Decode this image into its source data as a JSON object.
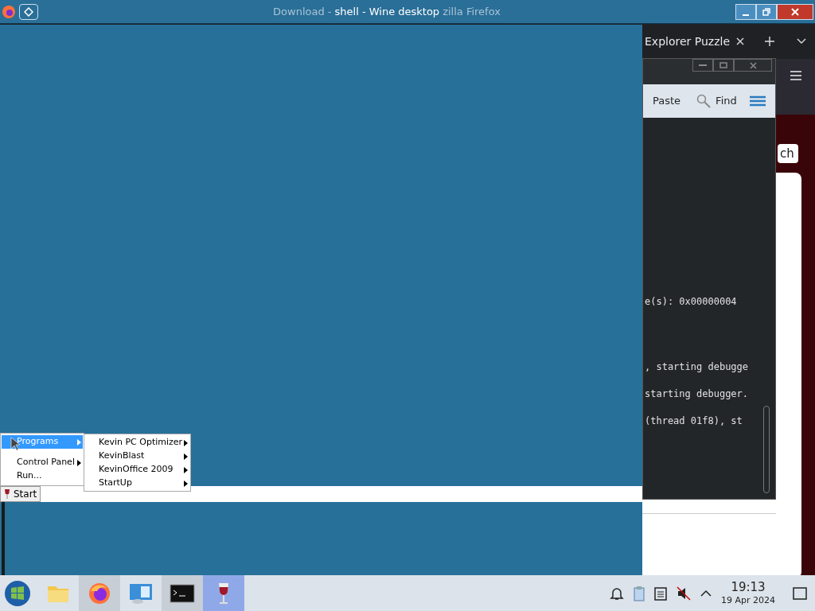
{
  "window": {
    "title": "shell - Wine desktop",
    "behind_title_left": "Download -",
    "behind_title_right": "zilla Firefox"
  },
  "start_menu": {
    "items": [
      {
        "label": "Programs",
        "selected": true,
        "submenu": true
      },
      {
        "label": "Control Panel",
        "selected": false,
        "submenu": true
      },
      {
        "label": "Run...",
        "selected": false,
        "submenu": false
      }
    ]
  },
  "submenu": {
    "items": [
      {
        "label": "Kevin PC Optimizer"
      },
      {
        "label": "KevinBlast"
      },
      {
        "label": "KevinOffice 2009"
      },
      {
        "label": "StartUp"
      }
    ]
  },
  "wine_taskbar": {
    "start": "Start"
  },
  "browser": {
    "tab": "Explorer Puzzle",
    "search_button": "ch"
  },
  "terminal": {
    "toolbar": [
      "Paste",
      "Find"
    ],
    "lines": [
      "e(s): 0x00000004",
      ", starting debugge",
      "starting debugger.",
      "(thread 01f8), st"
    ]
  },
  "taskbar": {
    "apps": [
      {
        "kind": "folder",
        "selected": false
      },
      {
        "kind": "firefox",
        "selected": true
      },
      {
        "kind": "remote",
        "selected": false
      },
      {
        "kind": "terminal",
        "selected": true
      },
      {
        "kind": "wine",
        "selected": true
      }
    ],
    "time": "19:13",
    "date": "19 Apr 2024"
  }
}
